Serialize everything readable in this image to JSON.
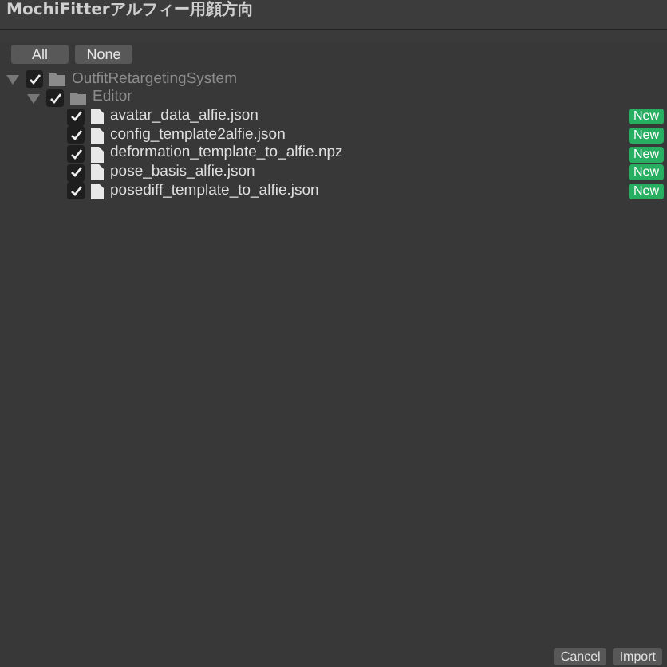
{
  "window": {
    "title": "MochiFitterアルフィー用顔方向"
  },
  "select_buttons": [
    "All",
    "None"
  ],
  "tree": [
    {
      "kind": "folder",
      "label": "OutfitRetargetingSystem",
      "checked": true,
      "expanded": true,
      "children": [
        {
          "kind": "folder",
          "label": "Editor",
          "checked": true,
          "expanded": true,
          "children": [
            {
              "kind": "file",
              "label": "avatar_data_alfie.json",
              "checked": true,
              "badge": "New"
            },
            {
              "kind": "file",
              "label": "config_template2alfie.json",
              "checked": true,
              "badge": "New"
            },
            {
              "kind": "file",
              "label": "deformation_template_to_alfie.npz",
              "checked": true,
              "badge": "New"
            },
            {
              "kind": "file",
              "label": "pose_basis_alfie.json",
              "checked": true,
              "badge": "New"
            },
            {
              "kind": "file",
              "label": "posediff_template_to_alfie.json",
              "checked": true,
              "badge": "New"
            }
          ]
        }
      ]
    }
  ],
  "footer_buttons": [
    "Cancel",
    "Import"
  ]
}
